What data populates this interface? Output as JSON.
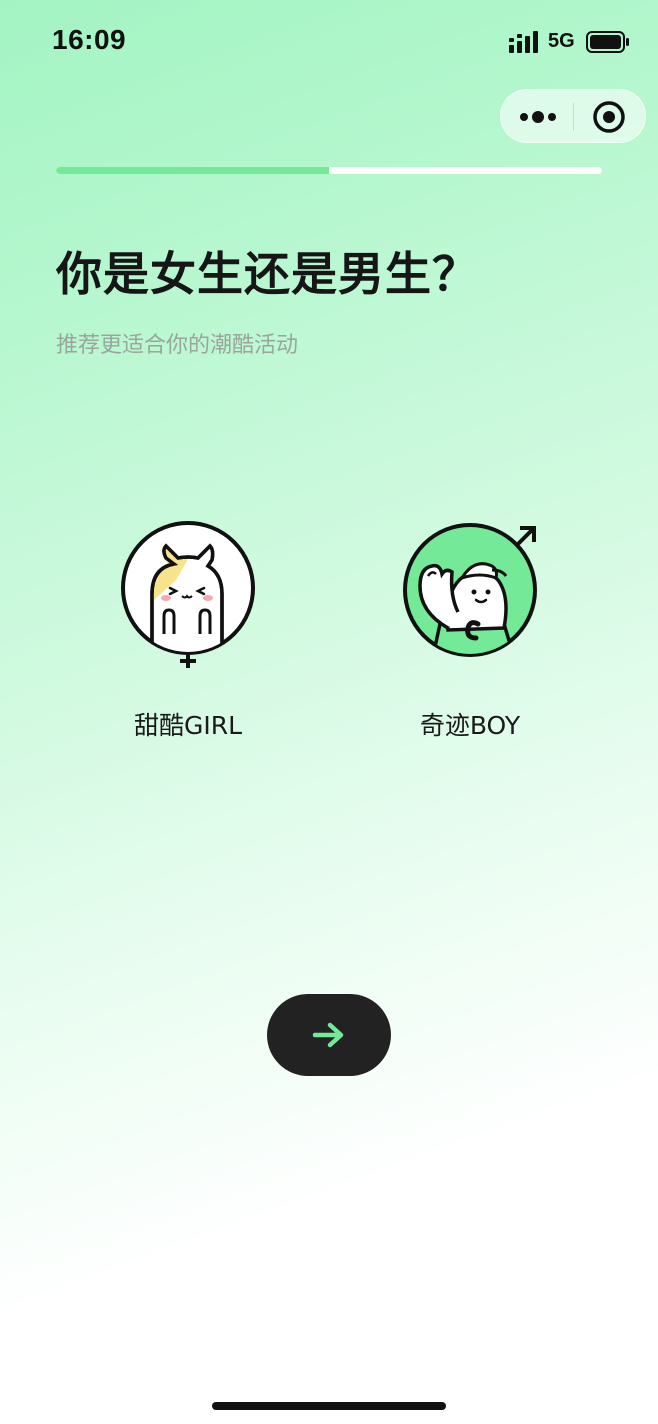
{
  "status_bar": {
    "time": "16:09",
    "network": "5G",
    "icons": [
      "signal-icon",
      "battery-icon"
    ]
  },
  "capsule": {
    "icons": [
      "more-dots-icon",
      "close-target-icon"
    ]
  },
  "progress": {
    "fraction": 0.5,
    "fill_color": "#74ea99"
  },
  "header": {
    "title": "你是女生还是男生？",
    "subtitle": "推荐更适合你的潮酷活动"
  },
  "options": [
    {
      "label": "甜酷GIRL",
      "icon": "girl-cat-avatar-icon"
    },
    {
      "label": "奇迹BOY",
      "icon": "boy-mascot-avatar-icon"
    }
  ],
  "next_button": {
    "icon": "arrow-right-icon",
    "background": "#222222",
    "arrow_color": "#74ea99"
  },
  "colors": {
    "accent": "#74ea99",
    "background_top": "#a3f4c3",
    "title": "#161616",
    "subtitle": "#9aa59e"
  }
}
